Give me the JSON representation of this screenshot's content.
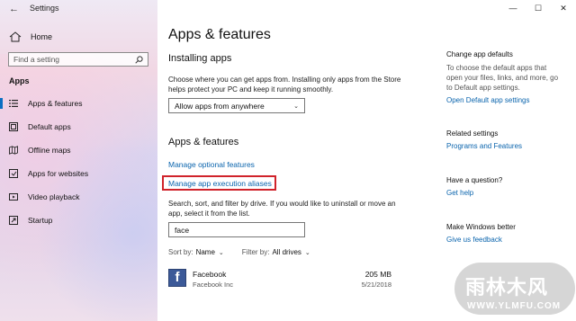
{
  "window": {
    "title": "Settings",
    "controls": {
      "minimize": "—",
      "maximize": "☐",
      "close": "✕"
    }
  },
  "sidebar": {
    "home_label": "Home",
    "search_placeholder": "Find a setting",
    "section_label": "Apps",
    "items": [
      {
        "label": "Apps & features",
        "icon": "apps-features-icon",
        "active": true
      },
      {
        "label": "Default apps",
        "icon": "default-apps-icon",
        "active": false
      },
      {
        "label": "Offline maps",
        "icon": "offline-maps-icon",
        "active": false
      },
      {
        "label": "Apps for websites",
        "icon": "apps-websites-icon",
        "active": false
      },
      {
        "label": "Video playback",
        "icon": "video-playback-icon",
        "active": false
      },
      {
        "label": "Startup",
        "icon": "startup-icon",
        "active": false
      }
    ]
  },
  "main": {
    "title": "Apps & features",
    "installing": {
      "heading": "Installing apps",
      "description": "Choose where you can get apps from. Installing only apps from the Store helps protect your PC and keep it running smoothly.",
      "dropdown_value": "Allow apps from anywhere"
    },
    "features": {
      "heading": "Apps & features",
      "link_optional": "Manage optional features",
      "link_aliases": "Manage app execution aliases",
      "description": "Search, sort, and filter by drive. If you would like to uninstall or move an app, select it from the list.",
      "search_value": "face",
      "sort_label": "Sort by:",
      "sort_value": "Name",
      "filter_label": "Filter by:",
      "filter_value": "All drives"
    },
    "apps": [
      {
        "name": "Facebook",
        "publisher": "Facebook Inc",
        "size": "205 MB",
        "date": "5/21/2018",
        "icon": "facebook-icon"
      }
    ]
  },
  "right_panel": {
    "change_defaults_heading": "Change app defaults",
    "change_defaults_text": "To choose the default apps that open your files, links, and more, go to Default app settings.",
    "open_default_link": "Open Default app settings",
    "related_heading": "Related settings",
    "programs_link": "Programs and Features",
    "question_heading": "Have a question?",
    "help_link": "Get help",
    "better_heading": "Make Windows better",
    "feedback_link": "Give us feedback"
  },
  "watermark": {
    "text": "雨林木风",
    "url": "WWW.YLMFU.COM"
  },
  "colors": {
    "accent": "#0b6fc2",
    "link": "#0a64ad",
    "highlight_box": "#d0232b",
    "facebook": "#3b5998"
  }
}
